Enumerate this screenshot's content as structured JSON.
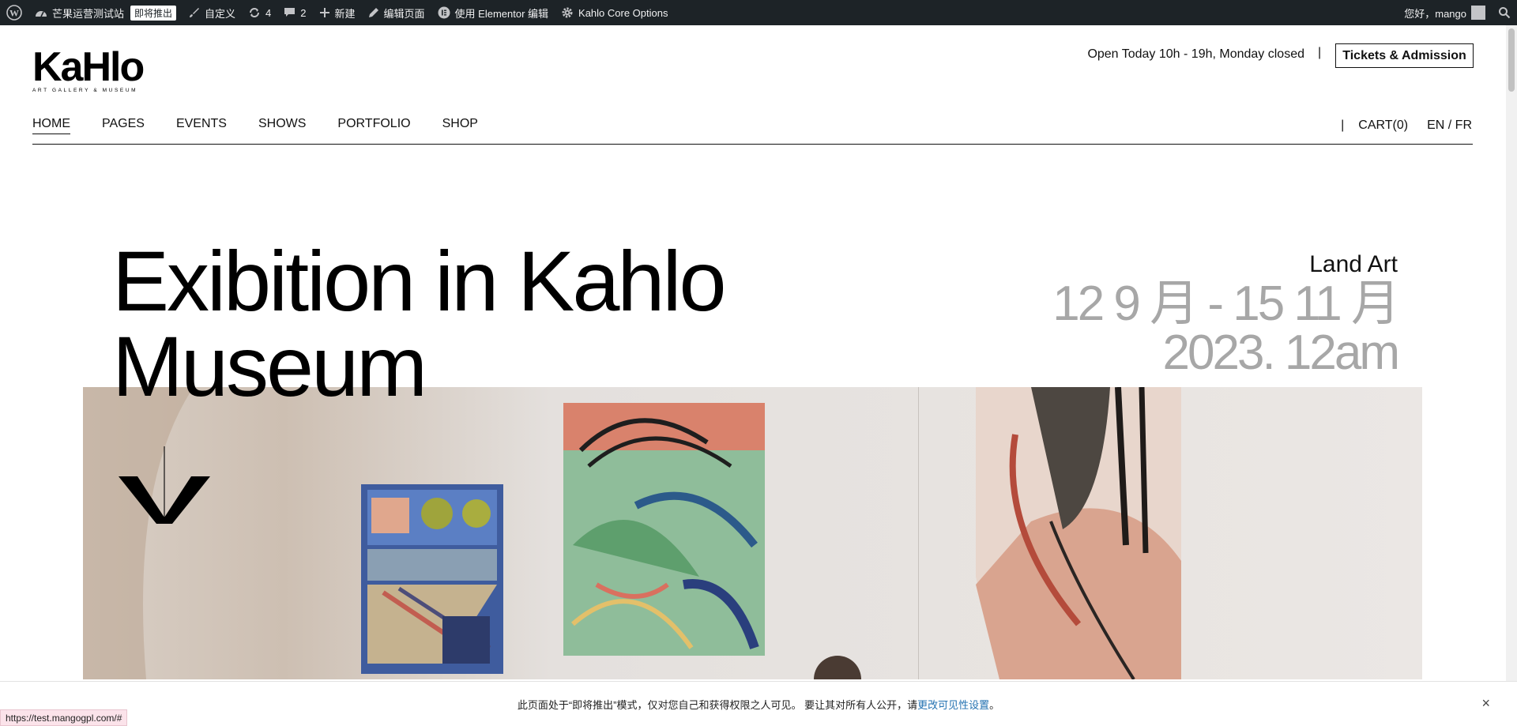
{
  "adminbar": {
    "site_name": "芒果运营测试站",
    "badge": "即将推出",
    "customize": "自定义",
    "updates_count": "4",
    "comments_count": "2",
    "new": "新建",
    "edit_page": "编辑页面",
    "elementor": "使用 Elementor 编辑",
    "core_options": "Kahlo Core Options",
    "greeting": "您好，mango"
  },
  "header": {
    "logo_text": "KaHlo",
    "logo_subtitle": "ART GALLERY & MUSEUM",
    "open_hours": "Open Today 10h - 19h, Monday closed",
    "separator": "|",
    "tickets_label": "Tickets & Admission"
  },
  "nav": {
    "items": [
      {
        "label": "HOME",
        "active": true
      },
      {
        "label": "PAGES"
      },
      {
        "label": "EVENTS"
      },
      {
        "label": "SHOWS"
      },
      {
        "label": "PORTFOLIO"
      },
      {
        "label": "SHOP"
      }
    ],
    "separator": "|",
    "cart": "CART(0)",
    "lang": "EN / FR"
  },
  "hero": {
    "title_line1": "Exibition in Kahlo",
    "title_line2": "Museum",
    "category": "Land Art",
    "date_line1": "12 9 月 - 15 11 月",
    "date_line2": "2023. 12am"
  },
  "notice": {
    "text": "此页面处于“即将推出”模式，仅对您自己和获得权限之人可见。 要让其对所有人公开，请",
    "link": "更改可见性设置",
    "end": "。",
    "close": "×"
  },
  "status_url": "https://test.mangogpl.com/#",
  "colors": {
    "adminbar_bg": "#1d2327",
    "date_gray": "#a7a7a7",
    "link_blue": "#2271b1"
  }
}
